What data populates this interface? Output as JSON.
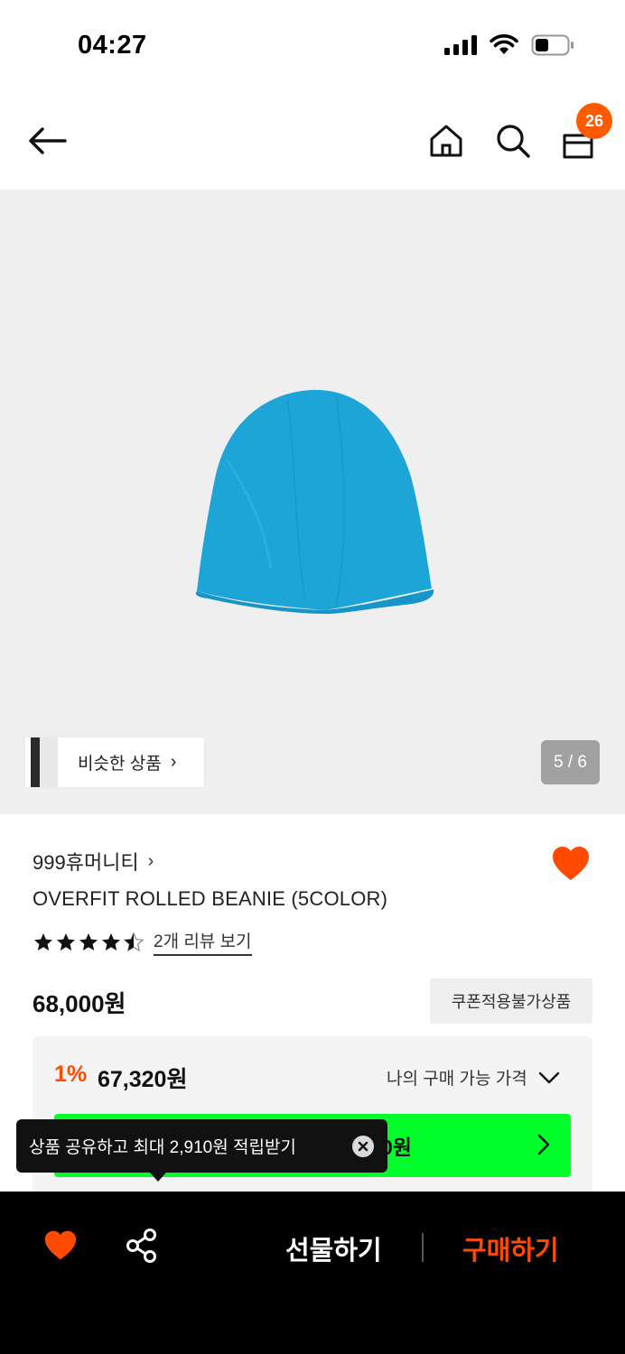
{
  "status_bar": {
    "time": "04:27"
  },
  "header": {
    "cart_count": "26"
  },
  "gallery": {
    "similar_label": "비슷한 상품",
    "page_indicator": "5 / 6",
    "product_color": "#1ea5d8"
  },
  "product": {
    "brand": "999휴머니티",
    "name": "OVERFIT ROLLED BEANIE (5COLOR)",
    "rating": 4.5,
    "review_link": "2개 리뷰 보기",
    "price": "68,000원",
    "coupon_notice": "쿠폰적용불가상품"
  },
  "my_price": {
    "discount_rate": "1%",
    "discount_price": "67,320원",
    "label": "나의 구매 가능 가격",
    "button_text_partial": "0원"
  },
  "tooltip": {
    "text": "상품 공유하고 최대 2,910원 적립받기"
  },
  "bottom_bar": {
    "gift_label": "선물하기",
    "buy_label": "구매하기"
  },
  "colors": {
    "accent": "#ff4a00",
    "green": "#00ff2a",
    "heart": "#ff4a00"
  }
}
